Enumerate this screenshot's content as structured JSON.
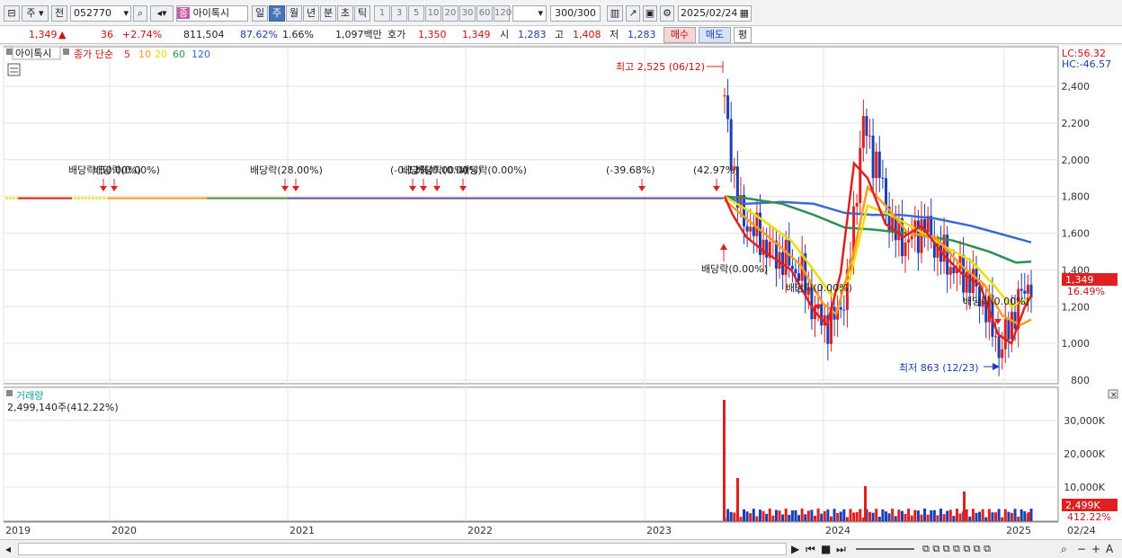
{
  "toolbar": {
    "market_type": "주",
    "scope": "전",
    "stock_code": "052770",
    "stock_badge": "종",
    "stock_name": "아이톡시",
    "periods": [
      "일",
      "주",
      "월",
      "년",
      "분",
      "초",
      "틱"
    ],
    "selected_period": "주",
    "intervals": [
      "1",
      "3",
      "5",
      "10",
      "20",
      "30",
      "60",
      "120"
    ],
    "count": "300/300",
    "date": "2025/02/24"
  },
  "quote": {
    "price": "1,349",
    "change_arrow": "▲",
    "change": "36",
    "change_rate": "+2.74%",
    "volume": "811,504",
    "vol_ratio": "87.62%",
    "turnover_rate": "1.66%",
    "amount": "1,097백만",
    "bid_label": "호가",
    "ask": "1,350",
    "bid": "1,349",
    "open_label": "시",
    "open": "1,283",
    "high_label": "고",
    "high": "1,408",
    "low_label": "저",
    "low": "1,283",
    "buy_label": "매수",
    "sell_label": "매도",
    "eval_label": "평"
  },
  "price_pane": {
    "legend_name": "아이톡시",
    "legend_series": "종가 단순",
    "ma_labels": [
      "5",
      "10",
      "20",
      "60",
      "120"
    ],
    "ma_colors": [
      "#e02020",
      "#ff9a1a",
      "#e8e000",
      "#2f8f4e",
      "#3a6ad6"
    ],
    "lc_label": "LC:56.32",
    "hc_label": "HC:-46.57",
    "current_price_tag": "1,349",
    "current_rate_tag": "16.49%",
    "y_ticks": [
      "2,400",
      "2,200",
      "2,000",
      "1,800",
      "1,600",
      "1,400",
      "1,200",
      "1,000",
      "800"
    ],
    "annotations": [
      {
        "id": "high",
        "text": "최고 2,525 (06/12)"
      },
      {
        "id": "low",
        "text": "최저 863 (12/23)"
      },
      {
        "id": "div1",
        "text": "배당락(50.00%)"
      },
      {
        "id": "div1b",
        "text": "배당락(0.00%)"
      },
      {
        "id": "div2",
        "text": "배당락(28.00%)"
      },
      {
        "id": "div3",
        "text": "(-0.12%)"
      },
      {
        "id": "div3b",
        "text": "배당락(0.00%)"
      },
      {
        "id": "div3c",
        "text": "배당락(0.00%)"
      },
      {
        "id": "div4",
        "text": "배당락(0.00%)"
      },
      {
        "id": "div5",
        "text": "(-39.68%)"
      },
      {
        "id": "up1",
        "text": "(42.97%)"
      },
      {
        "id": "div6",
        "text": "배당락(0.00%)"
      },
      {
        "id": "div7",
        "text": "배당락(0.00%)"
      }
    ]
  },
  "volume_pane": {
    "title": "거래량",
    "value_text": "2,499,140주(412.22%)",
    "y_ticks": [
      "30,000K",
      "20,000K",
      "10,000K"
    ],
    "current_tag": "2,499K",
    "current_rate": "412.22%"
  },
  "x_axis": {
    "labels": [
      "2019",
      "2020",
      "2021",
      "2022",
      "2023",
      "2024",
      "2025"
    ],
    "right_label": "02/24"
  },
  "chart_data": {
    "type": "candlestick",
    "title": "아이톡시",
    "y_range": [
      800,
      2480
    ],
    "weekly_close_approx": [
      {
        "x": "2019-2023.06",
        "y": 1790
      },
      {
        "x": "2023-06",
        "y": 2300
      },
      {
        "x": "2023-07",
        "y": 1700
      },
      {
        "x": "2023-08",
        "y": 1600
      },
      {
        "x": "2023-09",
        "y": 1500
      },
      {
        "x": "2023-10",
        "y": 1450
      },
      {
        "x": "2023-11",
        "y": 1380
      },
      {
        "x": "2023-12",
        "y": 1150
      },
      {
        "x": "2024-01",
        "y": 1100
      },
      {
        "x": "2024-02",
        "y": 1300
      },
      {
        "x": "2024-03",
        "y": 2200
      },
      {
        "x": "2024-04",
        "y": 1950
      },
      {
        "x": "2024-05",
        "y": 1600
      },
      {
        "x": "2024-06",
        "y": 1550
      },
      {
        "x": "2024-07",
        "y": 1650
      },
      {
        "x": "2024-08",
        "y": 1500
      },
      {
        "x": "2024-09",
        "y": 1400
      },
      {
        "x": "2024-10",
        "y": 1350
      },
      {
        "x": "2024-11",
        "y": 1200
      },
      {
        "x": "2024-12",
        "y": 950
      },
      {
        "x": "2025-01",
        "y": 1200
      },
      {
        "x": "2025-02",
        "y": 1349
      }
    ]
  },
  "statusbar": {
    "nav_buttons": [
      "▶",
      "⏮",
      "■",
      "⏭"
    ],
    "tools": [
      "zoom-out",
      "minus",
      "plus",
      "A"
    ]
  }
}
